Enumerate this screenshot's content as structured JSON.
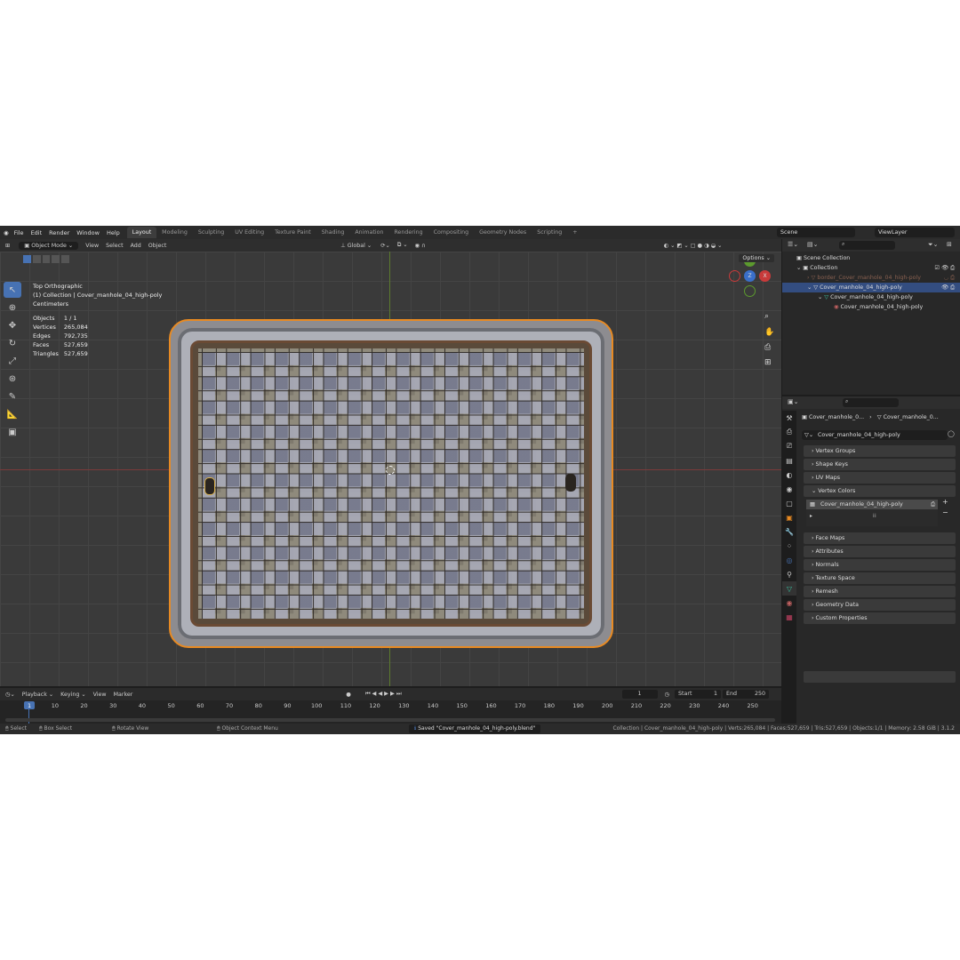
{
  "menu": [
    "File",
    "Edit",
    "Render",
    "Window",
    "Help"
  ],
  "workspaces": [
    "Layout",
    "Modeling",
    "Sculpting",
    "UV Editing",
    "Texture Paint",
    "Shading",
    "Animation",
    "Rendering",
    "Compositing",
    "Geometry Nodes",
    "Scripting"
  ],
  "active_workspace": "Layout",
  "scene": "Scene",
  "view_layer": "ViewLayer",
  "viewport_header": {
    "mode": "Object Mode",
    "menus": [
      "View",
      "Select",
      "Add",
      "Object"
    ],
    "transform_orientation": "Global",
    "options": "Options"
  },
  "overlay": {
    "view_name": "Top Orthographic",
    "collection": "(1) Collection | Cover_manhole_04_high-poly",
    "units": "Centimeters",
    "stats": [
      {
        "label": "Objects",
        "value": "1 / 1"
      },
      {
        "label": "Vertices",
        "value": "265,084"
      },
      {
        "label": "Edges",
        "value": "792,735"
      },
      {
        "label": "Faces",
        "value": "527,659"
      },
      {
        "label": "Triangles",
        "value": "527,659"
      }
    ]
  },
  "outliner": {
    "rows": [
      {
        "label": "Scene Collection"
      },
      {
        "label": "Collection"
      },
      {
        "label": "border_Cover_manhole_04_high-poly"
      },
      {
        "label": "Cover_manhole_04_high-poly"
      },
      {
        "label": "Cover_manhole_04_high-poly"
      },
      {
        "label": "Cover_manhole_04_high-poly"
      }
    ]
  },
  "properties": {
    "breadcrumb_object": "Cover_manhole_0...",
    "breadcrumb_data": "Cover_manhole_0...",
    "mesh_name": "Cover_manhole_04_high-poly",
    "panels": [
      "Vertex Groups",
      "Shape Keys",
      "UV Maps",
      "Vertex Colors",
      "Face Maps",
      "Attributes",
      "Normals",
      "Texture Space",
      "Remesh",
      "Geometry Data",
      "Custom Properties"
    ],
    "vertex_color_item": "Cover_manhole_04_high-poly"
  },
  "timeline": {
    "menus": [
      "Playback",
      "Keying",
      "View",
      "Marker"
    ],
    "current_frame": "1",
    "start_label": "Start",
    "start": "1",
    "end_label": "End",
    "end": "250",
    "ticks": [
      "1",
      "10",
      "20",
      "30",
      "40",
      "50",
      "60",
      "70",
      "80",
      "90",
      "100",
      "110",
      "120",
      "130",
      "140",
      "150",
      "160",
      "170",
      "180",
      "190",
      "200",
      "210",
      "220",
      "230",
      "240",
      "250"
    ]
  },
  "statusbar": {
    "select": "Select",
    "box_select": "Box Select",
    "rotate": "Rotate View",
    "context": "Object Context Menu",
    "message": "Saved \"Cover_manhole_04_high-poly.blend\"",
    "info": "Collection | Cover_manhole_04_high-poly | Verts:265,084 | Faces:527,659 | Tris:527,659 | Objects:1/1 | Memory: 2.58 GiB | 3.1.2"
  },
  "colors": {
    "accent": "#4772b3",
    "selection": "#e88a22",
    "x_axis": "#7a3a3a",
    "y_axis": "#5c7a2e"
  }
}
